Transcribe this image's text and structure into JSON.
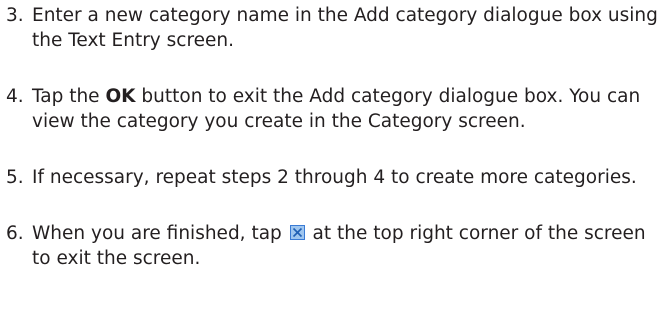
{
  "steps": [
    {
      "number": "3.",
      "text": "Enter a new category name in the Add category dialogue box using the Text Entry screen."
    },
    {
      "number": "4.",
      "pre": "Tap the ",
      "bold": "OK",
      "post": " button to exit the Add category dialogue box. You can view the category you create in the Category screen."
    },
    {
      "number": "5.",
      "text": "If necessary, repeat steps 2 through 4 to create more categories."
    },
    {
      "number": "6.",
      "pre": "When you are finished, tap ",
      "icon": "close-icon",
      "post": " at the top right corner of the screen to exit the screen."
    }
  ],
  "colors": {
    "text": "#231f20",
    "icon_fill": "#9fc6ef",
    "icon_border": "#3a7bd5",
    "icon_cross": "#1f5fb3"
  }
}
